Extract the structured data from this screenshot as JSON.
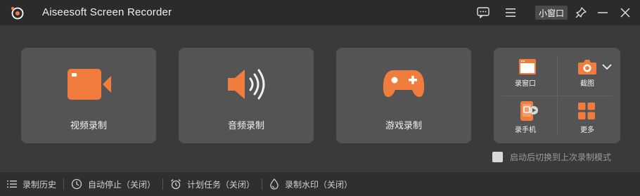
{
  "app": {
    "title": "Aiseesoft Screen Recorder"
  },
  "titlebar": {
    "mini_window_label": "小窗口",
    "icons": [
      "logo-icon",
      "feedback-icon",
      "menu-icon",
      "pin-icon",
      "minimize-icon",
      "close-icon"
    ]
  },
  "modes": {
    "video_label": "视频录制",
    "audio_label": "音频录制",
    "game_label": "游戏录制"
  },
  "tools": {
    "window_record_label": "录窗口",
    "screenshot_label": "截图",
    "phone_record_label": "录手机",
    "more_label": "更多",
    "expand_icon": "chevron-down-icon"
  },
  "options": {
    "resume_last_label": "启动后切换到上次录制模式",
    "resume_last_checked": false
  },
  "statusbar": {
    "history_label": "录制历史",
    "auto_stop_label": "自动停止（关闭）",
    "schedule_label": "计划任务（关闭）",
    "watermark_label": "录制水印（关闭）"
  },
  "colors": {
    "accent": "#f07c3e",
    "card_bg": "#545454",
    "window_bg": "#3a3a3a",
    "titlebar_bg": "#2b2b2b"
  }
}
